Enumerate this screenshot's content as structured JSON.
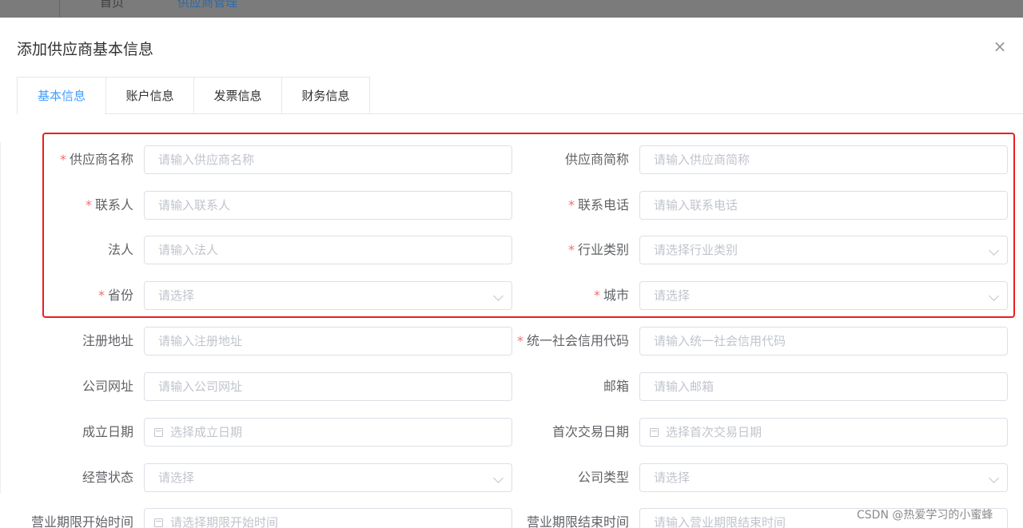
{
  "breadcrumb": {
    "home": "首页",
    "current": "供应商管理"
  },
  "dialog": {
    "title": "添加供应商基本信息",
    "close_icon": "×"
  },
  "tabs": [
    {
      "label": "基本信息",
      "active": true
    },
    {
      "label": "账户信息",
      "active": false
    },
    {
      "label": "发票信息",
      "active": false
    },
    {
      "label": "财务信息",
      "active": false
    }
  ],
  "form": {
    "supplier_name": {
      "label": "供应商名称",
      "placeholder": "请输入供应商名称",
      "required": true
    },
    "supplier_short": {
      "label": "供应商简称",
      "placeholder": "请输入供应商简称",
      "required": false
    },
    "contact": {
      "label": "联系人",
      "placeholder": "请输入联系人",
      "required": true
    },
    "contact_phone": {
      "label": "联系电话",
      "placeholder": "请输入联系电话",
      "required": true
    },
    "legal_person": {
      "label": "法人",
      "placeholder": "请输入法人",
      "required": false
    },
    "industry": {
      "label": "行业类别",
      "placeholder": "请选择行业类别",
      "required": true
    },
    "province": {
      "label": "省份",
      "placeholder": "请选择",
      "required": true
    },
    "city": {
      "label": "城市",
      "placeholder": "请选择",
      "required": true
    },
    "reg_address": {
      "label": "注册地址",
      "placeholder": "请输入注册地址",
      "required": false
    },
    "credit_code": {
      "label": "统一社会信用代码",
      "placeholder": "请输入统一社会信用代码",
      "required": true
    },
    "website": {
      "label": "公司网址",
      "placeholder": "请输入公司网址",
      "required": false
    },
    "email": {
      "label": "邮箱",
      "placeholder": "请输入邮箱",
      "required": false
    },
    "found_date": {
      "label": "成立日期",
      "placeholder": "选择成立日期",
      "required": false
    },
    "first_trade_date": {
      "label": "首次交易日期",
      "placeholder": "选择首次交易日期",
      "required": false
    },
    "biz_status": {
      "label": "经营状态",
      "placeholder": "请选择",
      "required": false
    },
    "company_type": {
      "label": "公司类型",
      "placeholder": "请选择",
      "required": false
    },
    "term_start": {
      "label": "营业期限开始时间",
      "placeholder": "请选择期限开始时间",
      "required": false
    },
    "term_end": {
      "label": "营业期限结束时间",
      "placeholder": "请输入营业期限结束时间",
      "required": false
    }
  },
  "required_mark": "*",
  "watermark": "CSDN @热爱学习的小蜜蜂",
  "colors": {
    "primary": "#409eff",
    "required": "#f56c6c",
    "highlight_box": "#ee1c1c"
  }
}
